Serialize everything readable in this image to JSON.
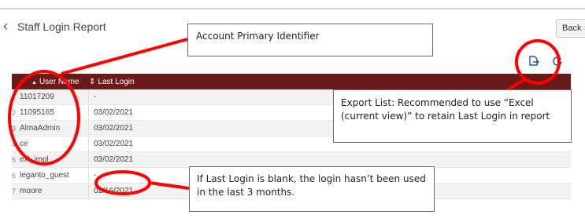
{
  "header": {
    "title": "Staff Login Report",
    "back_button_label": "Back"
  },
  "toolbar": {
    "export_icon": "export-icon",
    "refresh_icon": "refresh-icon"
  },
  "table": {
    "columns": [
      {
        "label": "User Name",
        "sort_glyph": "▲"
      },
      {
        "label": "Last Login",
        "sort_glyph": "⇕"
      }
    ],
    "rows": [
      {
        "idx": "1",
        "user": "11017209",
        "last": "-"
      },
      {
        "idx": "2",
        "user": "11095165",
        "last": "03/02/2021"
      },
      {
        "idx": "3",
        "user": "AlmaAdmin",
        "last": "03/02/2021"
      },
      {
        "idx": "4",
        "user": "ce",
        "last": "03/02/2021"
      },
      {
        "idx": "5",
        "user": "exl_impl",
        "last": "03/02/2021"
      },
      {
        "idx": "6",
        "user": "leganto_guest",
        "last": "-"
      },
      {
        "idx": "7",
        "user": "moore",
        "last": "02/16/2021"
      }
    ]
  },
  "callouts": {
    "account_identifier": "Account Primary Identifier",
    "export_list": "Export List: Recommended to use “Excel (current view)” to retain Last Login in report",
    "blank_login": "If Last Login is blank, the login hasn’t been used in the last 3 months."
  },
  "colors": {
    "header_bg": "#6b1a1a",
    "annotation_red": "#ff0000",
    "accent_blue": "#1f5f8b"
  }
}
